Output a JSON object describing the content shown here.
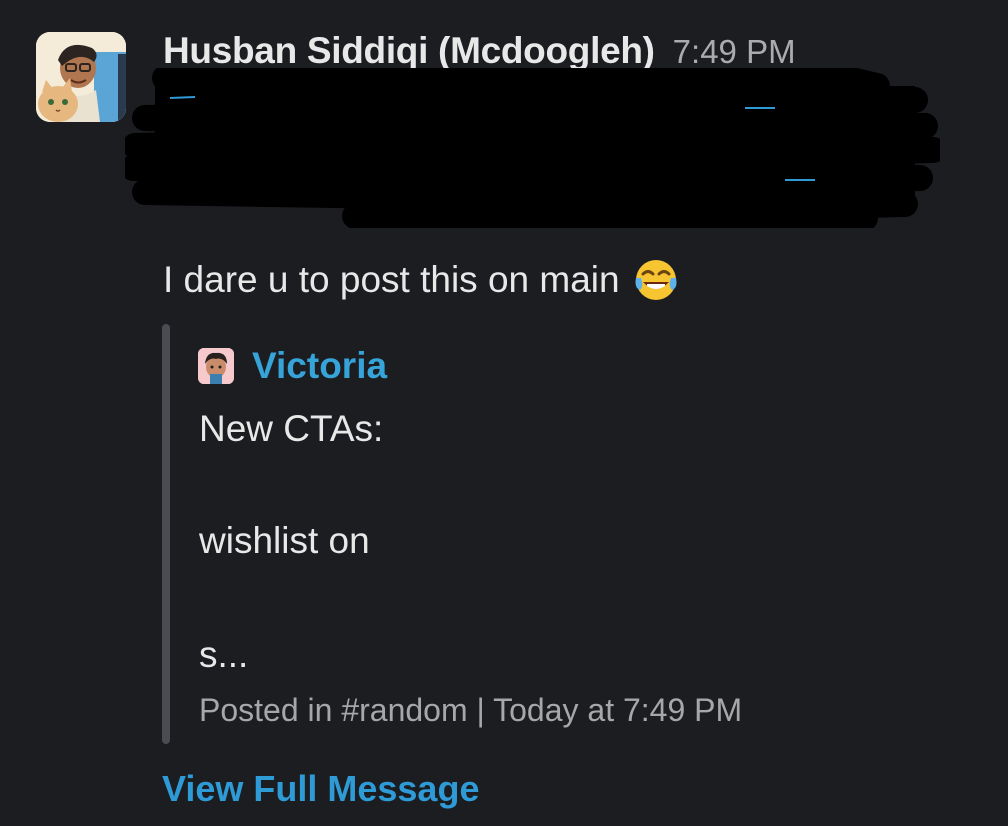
{
  "message": {
    "author": "Husban Siddiqi (Mcdoogleh)",
    "time": "7:49 PM",
    "text": "I dare u to post this on main",
    "emoji_icon": "face-with-tears-of-joy-icon",
    "avatar_icon": "user-avatar-cartoon"
  },
  "shared_message": {
    "author": "Victoria",
    "avatar_icon": "user-avatar-cartoon",
    "lines": [
      "New CTAs:",
      "wishlist on",
      "s..."
    ],
    "meta": "Posted in #random | Today at 7:49 PM"
  },
  "view_full_label": "View Full Message",
  "colors": {
    "background": "#1b1d21",
    "link": "#2e9ad6",
    "attachment_bar": "#4a4c51",
    "text": "#e8e8e8",
    "muted": "#ababad"
  }
}
